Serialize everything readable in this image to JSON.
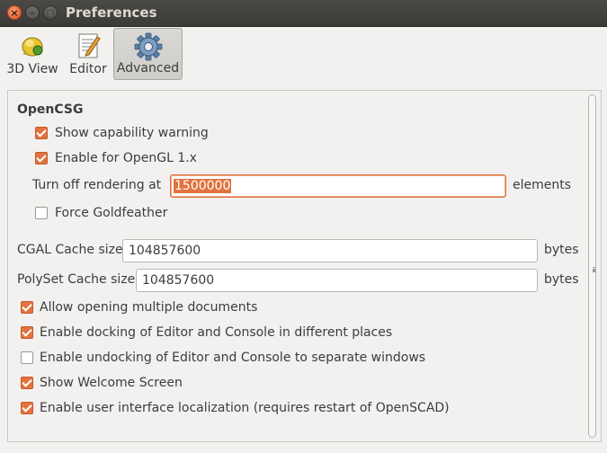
{
  "window": {
    "title": "Preferences",
    "close_glyph": "×",
    "min_glyph": "–",
    "max_glyph": "□"
  },
  "toolbar": {
    "items": [
      {
        "label": "3D View",
        "icon": "3d-view-icon"
      },
      {
        "label": "Editor",
        "icon": "editor-icon"
      },
      {
        "label": "Advanced",
        "icon": "gear-icon",
        "active": true
      }
    ]
  },
  "opencsg": {
    "title": "OpenCSG",
    "show_capability_warning": {
      "label": "Show capability warning",
      "checked": true
    },
    "enable_opengl1x": {
      "label": "Enable for OpenGL 1.x",
      "checked": true
    },
    "turn_off_rendering": {
      "label": "Turn off rendering at",
      "value": "1500000",
      "unit": "elements"
    },
    "force_goldfeather": {
      "label": "Force Goldfeather",
      "checked": false
    }
  },
  "cache": {
    "cgal": {
      "label": "CGAL Cache size",
      "value": "104857600",
      "unit": "bytes"
    },
    "polyset": {
      "label": "PolySet Cache size",
      "value": "104857600",
      "unit": "bytes"
    }
  },
  "options": [
    {
      "label": "Allow opening multiple documents",
      "checked": true
    },
    {
      "label": "Enable docking of Editor and Console in different places",
      "checked": true
    },
    {
      "label": "Enable undocking of Editor and Console to separate windows",
      "checked": false
    },
    {
      "label": "Show Welcome Screen",
      "checked": true
    },
    {
      "label": "Enable user interface localization (requires restart of OpenSCAD)",
      "checked": true
    }
  ],
  "colors": {
    "accent": "#e2733f",
    "titlebar": "#3c3b37",
    "background": "#f2f1f0"
  }
}
